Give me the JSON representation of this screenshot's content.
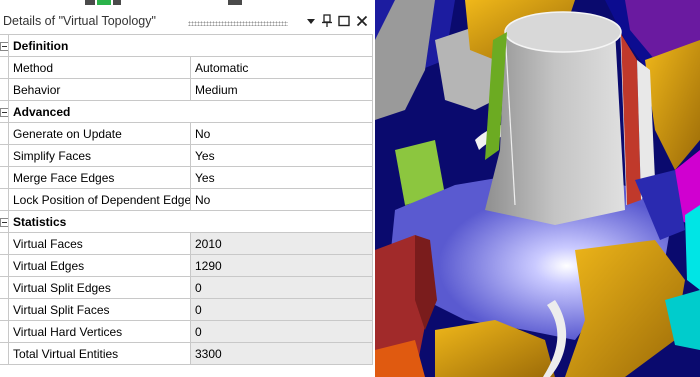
{
  "panel": {
    "title": "Details of \"Virtual Topology\"",
    "sections": [
      {
        "name": "Definition",
        "rows": [
          {
            "label": "Method",
            "value": "Automatic",
            "readonly": false
          },
          {
            "label": "Behavior",
            "value": "Medium",
            "readonly": false
          }
        ]
      },
      {
        "name": "Advanced",
        "rows": [
          {
            "label": "Generate on Update",
            "value": "No",
            "readonly": false
          },
          {
            "label": "Simplify Faces",
            "value": "Yes",
            "readonly": false
          },
          {
            "label": "Merge Face Edges",
            "value": "Yes",
            "readonly": false
          },
          {
            "label": "Lock Position of Dependent Edge Splits",
            "value": "No",
            "readonly": false
          }
        ]
      },
      {
        "name": "Statistics",
        "rows": [
          {
            "label": "Virtual Faces",
            "value": "2010",
            "readonly": true
          },
          {
            "label": "Virtual Edges",
            "value": "1290",
            "readonly": true
          },
          {
            "label": "Virtual Split Edges",
            "value": "0",
            "readonly": true
          },
          {
            "label": "Virtual Split Faces",
            "value": "0",
            "readonly": true
          },
          {
            "label": "Virtual Hard Vertices",
            "value": "0",
            "readonly": true
          },
          {
            "label": "Total Virtual Entities",
            "value": "3300",
            "readonly": true
          }
        ]
      }
    ]
  },
  "titlebar_buttons": [
    {
      "name": "dropdown-arrow-icon",
      "glyph": "▾"
    },
    {
      "name": "pin-icon",
      "glyph": "pin"
    },
    {
      "name": "maximize-icon",
      "glyph": "□"
    },
    {
      "name": "close-icon",
      "glyph": "✕"
    }
  ],
  "colors": {
    "grid_line": "#c8c8c8",
    "readonly_bg": "#ebebeb",
    "viewport_bg": "#0a0a6e",
    "model_gray": "#b8b8b8",
    "model_blue": "#6b6bd8",
    "model_gold": "#d4a017",
    "model_green": "#8cc63f",
    "model_red": "#c0392b",
    "model_cyan": "#00e5e5",
    "model_magenta": "#d000d0"
  }
}
